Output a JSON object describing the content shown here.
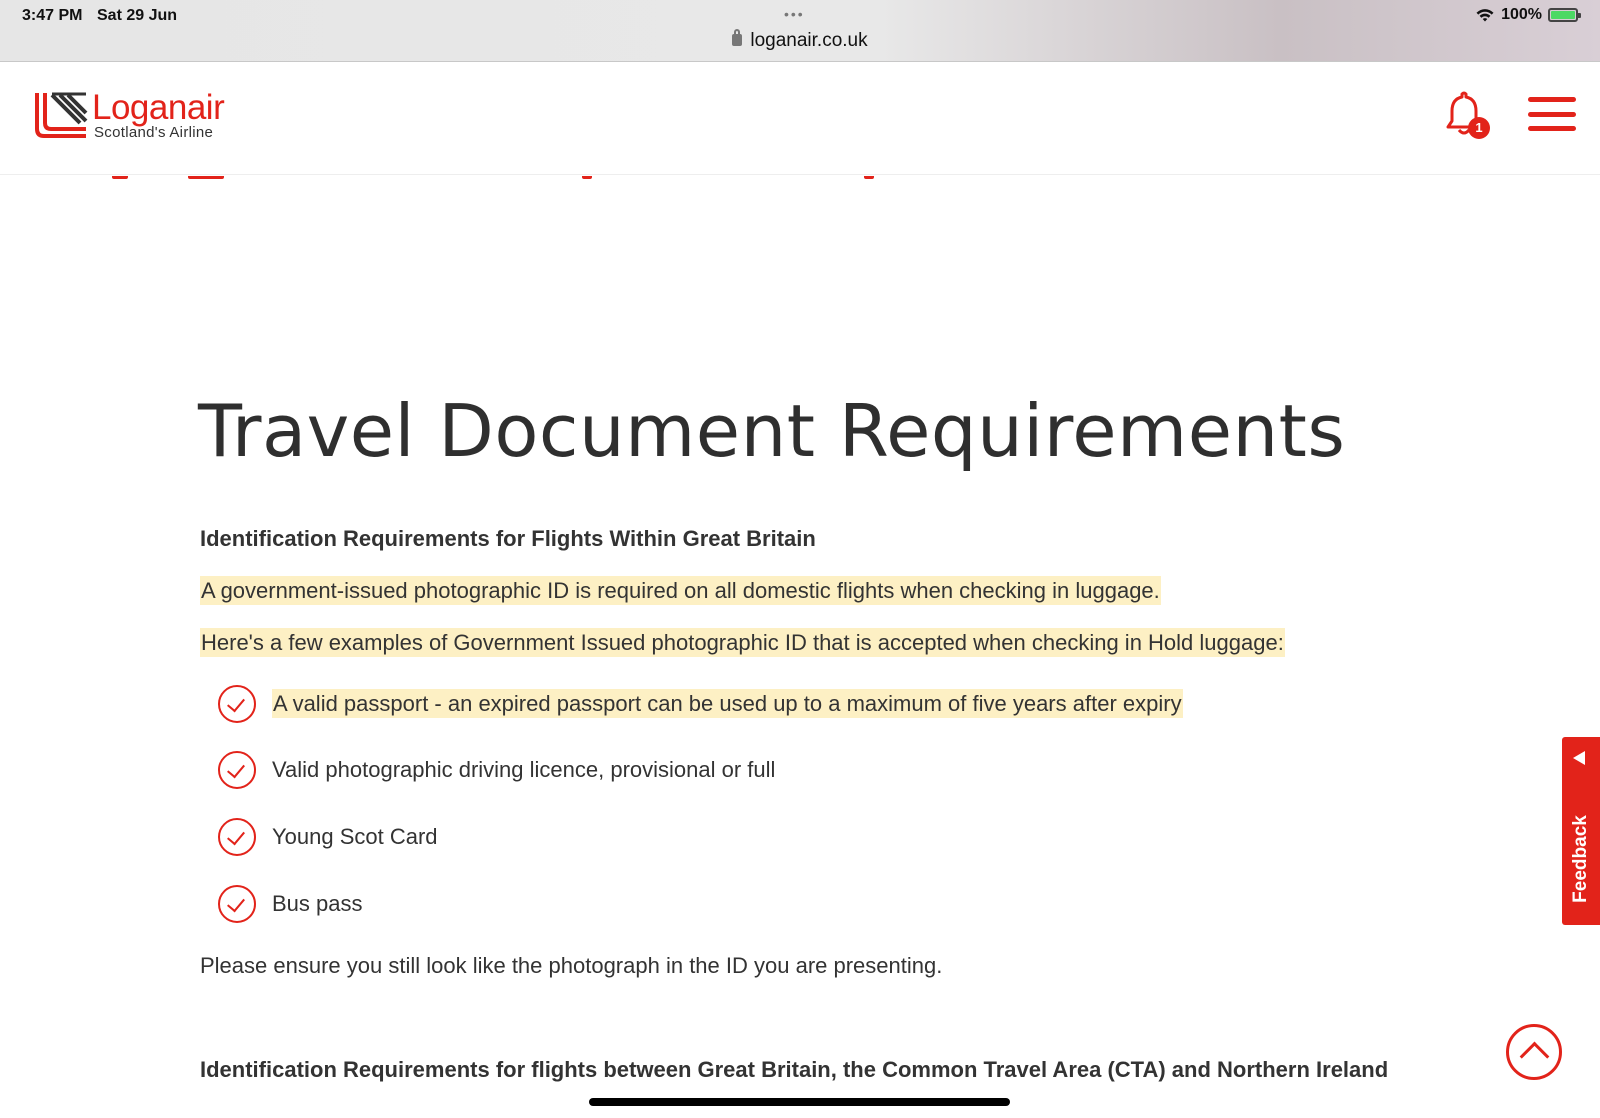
{
  "status_bar": {
    "time": "3:47 PM",
    "date": "Sat 29 Jun",
    "url": "loganair.co.uk",
    "battery": "100%"
  },
  "header": {
    "logo_name": "Loganair",
    "logo_tagline": "Scotland's Airline",
    "notification_count": "1"
  },
  "content": {
    "title": "Travel Document Requirements",
    "section1_heading": "Identification Requirements for Flights Within Great Britain",
    "para1": "A government-issued photographic ID is required on all domestic flights when checking in luggage.",
    "para2": "Here's a few examples of Government Issued photographic ID that is accepted when checking in Hold luggage:",
    "id_list": [
      "A valid passport - an expired passport can be used up to a maximum of five years after expiry",
      "Valid photographic driving licence, provisional or full",
      "Young Scot Card",
      "Bus pass"
    ],
    "para3": "Please ensure you still look like the photograph in the ID you are presenting.",
    "section2_heading": "Identification Requirements for flights between Great Britain, the Common Travel Area (CTA) and Northern Ireland"
  },
  "feedback": {
    "label": "Feedback"
  },
  "colors": {
    "brand_red": "#e2231a",
    "highlight": "#fdf0c4"
  }
}
